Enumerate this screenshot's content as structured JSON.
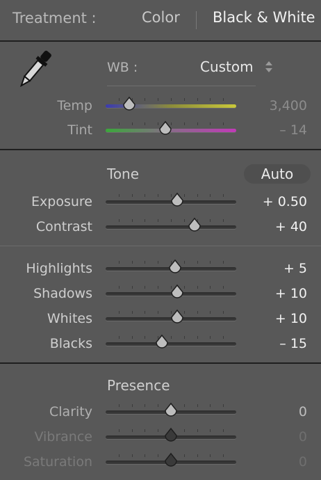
{
  "treatment": {
    "label": "Treatment :",
    "options": [
      "Color",
      "Black & White"
    ],
    "selected": "Black & White"
  },
  "wb": {
    "label": "WB :",
    "value": "Custom"
  },
  "basic_sliders": [
    {
      "label": "Temp",
      "value": "3,400",
      "position": 0.18,
      "track": "temp",
      "dim": true
    },
    {
      "label": "Tint",
      "value": "– 14",
      "position": 0.46,
      "track": "tint",
      "dim": true
    }
  ],
  "tone": {
    "title": "Tone",
    "auto_label": "Auto"
  },
  "tone_sliders": [
    {
      "label": "Exposure",
      "value": "+ 0.50",
      "position": 0.55,
      "track": "plain"
    },
    {
      "label": "Contrast",
      "value": "+ 40",
      "position": 0.68,
      "track": "plain"
    }
  ],
  "tone_sliders_2": [
    {
      "label": "Highlights",
      "value": "+ 5",
      "position": 0.53,
      "track": "plain"
    },
    {
      "label": "Shadows",
      "value": "+ 10",
      "position": 0.55,
      "track": "plain"
    },
    {
      "label": "Whites",
      "value": "+ 10",
      "position": 0.55,
      "track": "plain"
    },
    {
      "label": "Blacks",
      "value": "– 15",
      "position": 0.43,
      "track": "plain"
    }
  ],
  "presence": {
    "title": "Presence"
  },
  "presence_sliders": [
    {
      "label": "Clarity",
      "value": "0",
      "position": 0.5,
      "track": "plain",
      "state": "dim"
    },
    {
      "label": "Vibrance",
      "value": "0",
      "position": 0.5,
      "track": "plain",
      "state": "disabled"
    },
    {
      "label": "Saturation",
      "value": "0",
      "position": 0.5,
      "track": "plain",
      "state": "disabled"
    }
  ],
  "colors": {
    "temp_gradient": [
      "#3b3bb0",
      "#8c8c3a",
      "#c9c83a"
    ],
    "tint_gradient": [
      "#3aa83a",
      "#8a6a8a",
      "#c13ab8"
    ]
  }
}
